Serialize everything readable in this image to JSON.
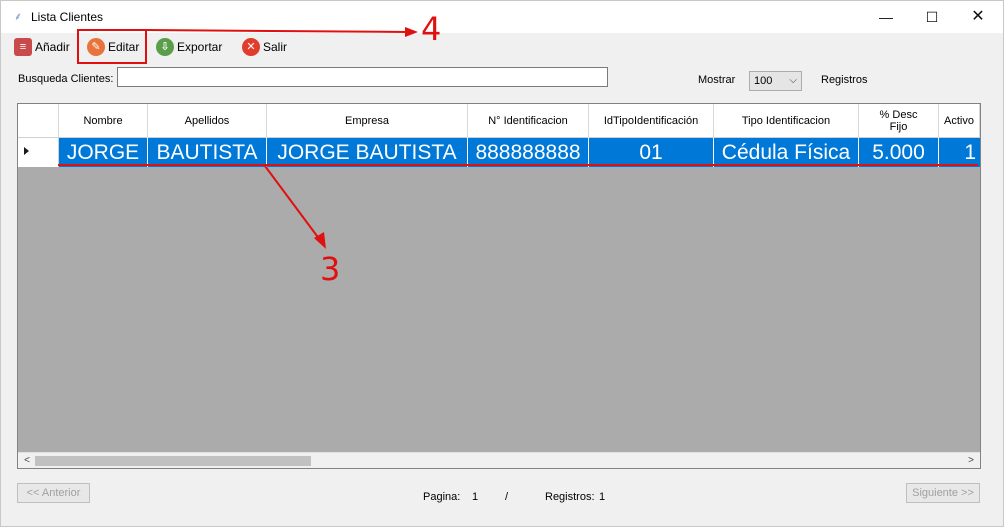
{
  "window": {
    "title": "Lista Clientes",
    "controls": {
      "minimize": "—",
      "maximize": "☐",
      "close": "✕"
    }
  },
  "toolbar": {
    "add_label": "Añadir",
    "edit_label": "Editar",
    "export_label": "Exportar",
    "exit_label": "Salir"
  },
  "search": {
    "label": "Busqueda Clientes:",
    "value": "",
    "placeholder": ""
  },
  "page_size": {
    "label": "Mostrar",
    "selected": "100",
    "suffix": "Registros"
  },
  "grid": {
    "columns": [
      "Nombre",
      "Apellidos",
      "Empresa",
      "N° Identificacion",
      "IdTipoIdentificación",
      "Tipo Identificacion",
      "% Desc Fijo",
      "Activo"
    ],
    "rows": [
      [
        "JORGE",
        "BAUTISTA",
        "JORGE BAUTISTA",
        "888888888",
        "01",
        "Cédula Física",
        "5.000",
        "1"
      ]
    ]
  },
  "pagination": {
    "prev_label": "<< Anterior",
    "next_label": "Siguiente >>",
    "page_label": "Pagina:",
    "page_value": "1",
    "separator": "/",
    "records_label": "Registros:",
    "records_value": "1"
  },
  "annotations": {
    "label_4": "4",
    "label_3": "3",
    "color": "#e01010"
  },
  "colors": {
    "selection": "#0078d7",
    "grid_background": "#ababab"
  }
}
